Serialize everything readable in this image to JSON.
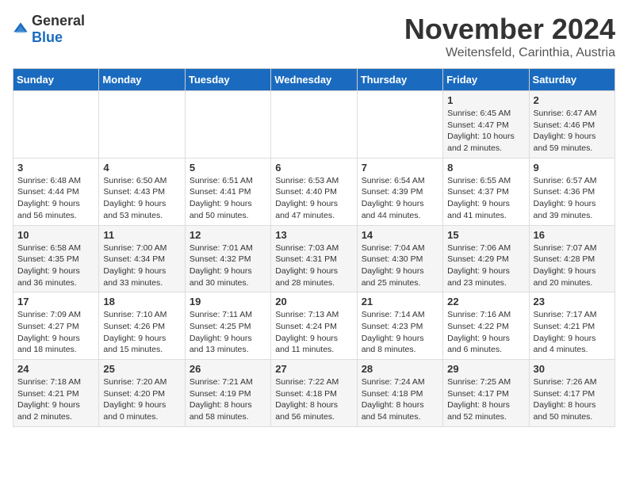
{
  "header": {
    "logo_general": "General",
    "logo_blue": "Blue",
    "month_title": "November 2024",
    "location": "Weitensfeld, Carinthia, Austria"
  },
  "days_of_week": [
    "Sunday",
    "Monday",
    "Tuesday",
    "Wednesday",
    "Thursday",
    "Friday",
    "Saturday"
  ],
  "weeks": [
    [
      {
        "day": "",
        "info": ""
      },
      {
        "day": "",
        "info": ""
      },
      {
        "day": "",
        "info": ""
      },
      {
        "day": "",
        "info": ""
      },
      {
        "day": "",
        "info": ""
      },
      {
        "day": "1",
        "info": "Sunrise: 6:45 AM\nSunset: 4:47 PM\nDaylight: 10 hours and 2 minutes."
      },
      {
        "day": "2",
        "info": "Sunrise: 6:47 AM\nSunset: 4:46 PM\nDaylight: 9 hours and 59 minutes."
      }
    ],
    [
      {
        "day": "3",
        "info": "Sunrise: 6:48 AM\nSunset: 4:44 PM\nDaylight: 9 hours and 56 minutes."
      },
      {
        "day": "4",
        "info": "Sunrise: 6:50 AM\nSunset: 4:43 PM\nDaylight: 9 hours and 53 minutes."
      },
      {
        "day": "5",
        "info": "Sunrise: 6:51 AM\nSunset: 4:41 PM\nDaylight: 9 hours and 50 minutes."
      },
      {
        "day": "6",
        "info": "Sunrise: 6:53 AM\nSunset: 4:40 PM\nDaylight: 9 hours and 47 minutes."
      },
      {
        "day": "7",
        "info": "Sunrise: 6:54 AM\nSunset: 4:39 PM\nDaylight: 9 hours and 44 minutes."
      },
      {
        "day": "8",
        "info": "Sunrise: 6:55 AM\nSunset: 4:37 PM\nDaylight: 9 hours and 41 minutes."
      },
      {
        "day": "9",
        "info": "Sunrise: 6:57 AM\nSunset: 4:36 PM\nDaylight: 9 hours and 39 minutes."
      }
    ],
    [
      {
        "day": "10",
        "info": "Sunrise: 6:58 AM\nSunset: 4:35 PM\nDaylight: 9 hours and 36 minutes."
      },
      {
        "day": "11",
        "info": "Sunrise: 7:00 AM\nSunset: 4:34 PM\nDaylight: 9 hours and 33 minutes."
      },
      {
        "day": "12",
        "info": "Sunrise: 7:01 AM\nSunset: 4:32 PM\nDaylight: 9 hours and 30 minutes."
      },
      {
        "day": "13",
        "info": "Sunrise: 7:03 AM\nSunset: 4:31 PM\nDaylight: 9 hours and 28 minutes."
      },
      {
        "day": "14",
        "info": "Sunrise: 7:04 AM\nSunset: 4:30 PM\nDaylight: 9 hours and 25 minutes."
      },
      {
        "day": "15",
        "info": "Sunrise: 7:06 AM\nSunset: 4:29 PM\nDaylight: 9 hours and 23 minutes."
      },
      {
        "day": "16",
        "info": "Sunrise: 7:07 AM\nSunset: 4:28 PM\nDaylight: 9 hours and 20 minutes."
      }
    ],
    [
      {
        "day": "17",
        "info": "Sunrise: 7:09 AM\nSunset: 4:27 PM\nDaylight: 9 hours and 18 minutes."
      },
      {
        "day": "18",
        "info": "Sunrise: 7:10 AM\nSunset: 4:26 PM\nDaylight: 9 hours and 15 minutes."
      },
      {
        "day": "19",
        "info": "Sunrise: 7:11 AM\nSunset: 4:25 PM\nDaylight: 9 hours and 13 minutes."
      },
      {
        "day": "20",
        "info": "Sunrise: 7:13 AM\nSunset: 4:24 PM\nDaylight: 9 hours and 11 minutes."
      },
      {
        "day": "21",
        "info": "Sunrise: 7:14 AM\nSunset: 4:23 PM\nDaylight: 9 hours and 8 minutes."
      },
      {
        "day": "22",
        "info": "Sunrise: 7:16 AM\nSunset: 4:22 PM\nDaylight: 9 hours and 6 minutes."
      },
      {
        "day": "23",
        "info": "Sunrise: 7:17 AM\nSunset: 4:21 PM\nDaylight: 9 hours and 4 minutes."
      }
    ],
    [
      {
        "day": "24",
        "info": "Sunrise: 7:18 AM\nSunset: 4:21 PM\nDaylight: 9 hours and 2 minutes."
      },
      {
        "day": "25",
        "info": "Sunrise: 7:20 AM\nSunset: 4:20 PM\nDaylight: 9 hours and 0 minutes."
      },
      {
        "day": "26",
        "info": "Sunrise: 7:21 AM\nSunset: 4:19 PM\nDaylight: 8 hours and 58 minutes."
      },
      {
        "day": "27",
        "info": "Sunrise: 7:22 AM\nSunset: 4:18 PM\nDaylight: 8 hours and 56 minutes."
      },
      {
        "day": "28",
        "info": "Sunrise: 7:24 AM\nSunset: 4:18 PM\nDaylight: 8 hours and 54 minutes."
      },
      {
        "day": "29",
        "info": "Sunrise: 7:25 AM\nSunset: 4:17 PM\nDaylight: 8 hours and 52 minutes."
      },
      {
        "day": "30",
        "info": "Sunrise: 7:26 AM\nSunset: 4:17 PM\nDaylight: 8 hours and 50 minutes."
      }
    ]
  ]
}
